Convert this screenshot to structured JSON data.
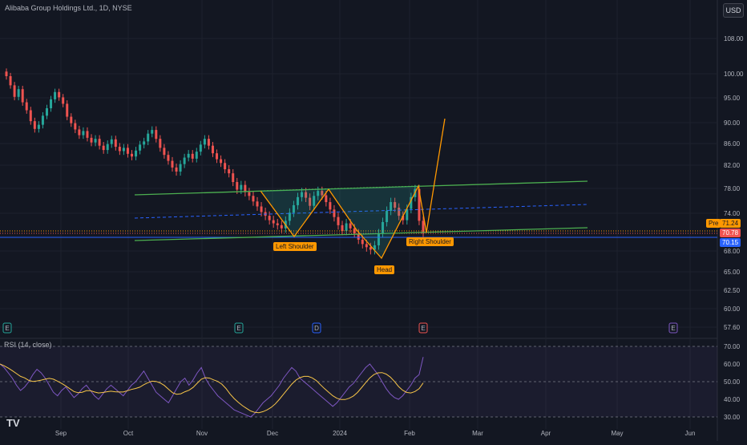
{
  "header": {
    "title": "Alibaba Group Holdings Ltd., 1D, NYSE",
    "currency_button": "USD"
  },
  "rsi": {
    "label": "RSI (14, close)",
    "ticks": [
      "70.00",
      "60.00",
      "50.00",
      "40.00",
      "30.00"
    ]
  },
  "price_axis_ticks": [
    "108.00",
    "100.00",
    "95.00",
    "90.00",
    "86.00",
    "82.00",
    "78.00",
    "74.00",
    "68.00",
    "65.00",
    "62.50",
    "60.00",
    "57.60"
  ],
  "price_tags": {
    "pre_label": "Pre",
    "pre_value": "71.24",
    "last_value": "70.78",
    "line_value": "70.15"
  },
  "time_axis": [
    "Sep",
    "Oct",
    "Nov",
    "Dec",
    "2024",
    "Feb",
    "Mar",
    "Apr",
    "May",
    "Jun"
  ],
  "events": [
    "E",
    "E",
    "D",
    "E",
    "E"
  ],
  "annotations": {
    "left_shoulder": "Left Shoulder",
    "head": "Head",
    "right_shoulder": "Right Shoulder"
  },
  "colors": {
    "up": "#26a69a",
    "down": "#ef5350",
    "neckline": "#4caf50",
    "pattern": "#ff9800",
    "rsi": "#7e57c2",
    "rsi_ma": "#f7c548",
    "blue_line": "#2962ff"
  },
  "chart_data": {
    "type": "candlestick",
    "title": "Alibaba Group Holdings Ltd., 1D, NYSE",
    "ylim": [
      57.6,
      110
    ],
    "ohlc_close": [
      99.5,
      97.6,
      95.2,
      96.8,
      94.1,
      92.5,
      90.3,
      88.8,
      89.6,
      91.4,
      92.9,
      94.7,
      96.2,
      95.1,
      93.8,
      91.2,
      89.9,
      88.7,
      87.6,
      88.4,
      87.1,
      86.2,
      86.9,
      85.6,
      84.8,
      85.9,
      86.8,
      85.4,
      84.6,
      85.2,
      84.1,
      83.6,
      84.7,
      85.8,
      86.4,
      87.9,
      88.6,
      86.9,
      85.2,
      83.9,
      82.8,
      81.6,
      80.9,
      82.2,
      83.4,
      84.1,
      83.2,
      84.5,
      85.8,
      86.9,
      85.6,
      84.2,
      83.1,
      82.4,
      81.3,
      80.6,
      79.1,
      77.8,
      78.6,
      77.4,
      76.8,
      75.9,
      75.1,
      74.2,
      73.6,
      72.9,
      72.4,
      72.1,
      71.6,
      72.8,
      74.1,
      75.3,
      76.6,
      77.4,
      76.5,
      75.2,
      76.8,
      77.6,
      76.9,
      75.8,
      74.6,
      73.4,
      72.1,
      71.2,
      72.4,
      71.6,
      70.8,
      69.8,
      69.1,
      68.6,
      68.2,
      68.9,
      70.8,
      72.6,
      74.4,
      75.8,
      74.9,
      73.6,
      72.9,
      74.7,
      76.6,
      77.9,
      72.8,
      70.78
    ],
    "rsi_values": [
      60,
      58,
      55,
      52,
      48,
      45,
      47,
      50,
      54,
      57,
      55,
      52,
      48,
      44,
      42,
      45,
      47,
      44,
      41,
      43,
      46,
      48,
      45,
      42,
      40,
      43,
      46,
      48,
      46,
      44,
      42,
      45,
      48,
      50,
      53,
      56,
      52,
      48,
      44,
      42,
      40,
      38,
      42,
      46,
      50,
      52,
      48,
      51,
      55,
      58,
      52,
      48,
      45,
      42,
      40,
      38,
      36,
      34,
      33,
      32,
      31,
      30,
      32,
      35,
      38,
      40,
      42,
      45,
      48,
      52,
      55,
      58,
      56,
      52,
      50,
      48,
      46,
      44,
      42,
      40,
      38,
      36,
      38,
      41,
      44,
      47,
      49,
      52,
      55,
      58,
      60,
      57,
      54,
      50,
      46,
      43,
      41,
      40,
      42,
      45,
      48,
      52,
      54,
      64
    ]
  }
}
